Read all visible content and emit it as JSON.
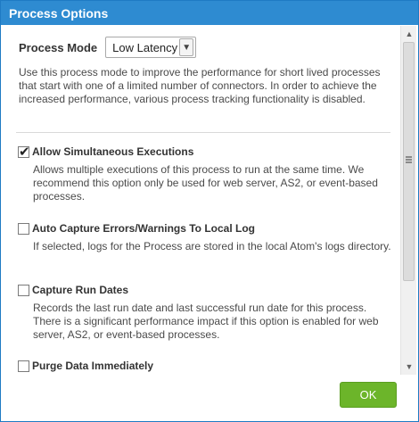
{
  "dialog": {
    "title": "Process Options",
    "ok_label": "OK"
  },
  "process_mode": {
    "label": "Process Mode",
    "selected": "Low Latency",
    "description": "Use this process mode to improve the performance for short lived processes that start with one of a limited number of connectors. In order to achieve the increased performance, various process tracking functionality is disabled."
  },
  "options": [
    {
      "label": "Allow Simultaneous Executions",
      "checked": true,
      "description": "Allows multiple executions of this process to run at the same time. We recommend this option only be used for web server, AS2, or event-based processes."
    },
    {
      "label": "Auto Capture Errors/Warnings To Local Log",
      "checked": false,
      "description": "If selected, logs for the Process are stored in the local Atom's logs directory."
    },
    {
      "label": "Capture Run Dates",
      "checked": false,
      "description": "Records the last run date and last successful run date for this process. There is a significant performance impact if this option is enabled for web server, AS2, or event-based processes."
    },
    {
      "label": "Purge Data Immediately",
      "checked": false,
      "description": ""
    }
  ],
  "colors": {
    "titlebar": "#2e8bd1",
    "ok_button": "#6cb52a"
  },
  "icons": {
    "select_arrow": "chevron-down-icon",
    "scroll_up": "scroll-up-icon",
    "scroll_down": "scroll-down-icon",
    "checked": "checkmark-icon"
  }
}
